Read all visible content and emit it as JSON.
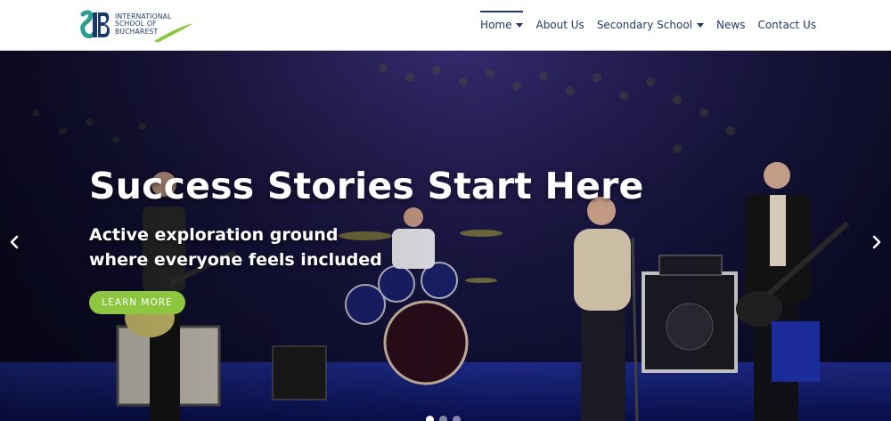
{
  "brand": {
    "logo_lines": [
      "INTERNATIONAL",
      "SCHOOL OF",
      "BUCHAREST"
    ],
    "accent_green": "#8dc63f",
    "navy": "#1f3864"
  },
  "nav": {
    "items": [
      {
        "label": "Home",
        "has_dropdown": true,
        "active": true
      },
      {
        "label": "About Us",
        "has_dropdown": false,
        "active": false
      },
      {
        "label": "Secondary School",
        "has_dropdown": true,
        "active": false
      },
      {
        "label": "News",
        "has_dropdown": false,
        "active": false
      },
      {
        "label": "Contact Us",
        "has_dropdown": false,
        "active": false
      }
    ]
  },
  "hero": {
    "headline": "Success Stories Start Here",
    "subline_1": "Active exploration ground",
    "subline_2": "where everyone feels included",
    "cta_label": "LEARN MORE",
    "prev_icon": "chevron-left-icon",
    "next_icon": "chevron-right-icon",
    "slides_count": 3,
    "active_slide": 1
  }
}
